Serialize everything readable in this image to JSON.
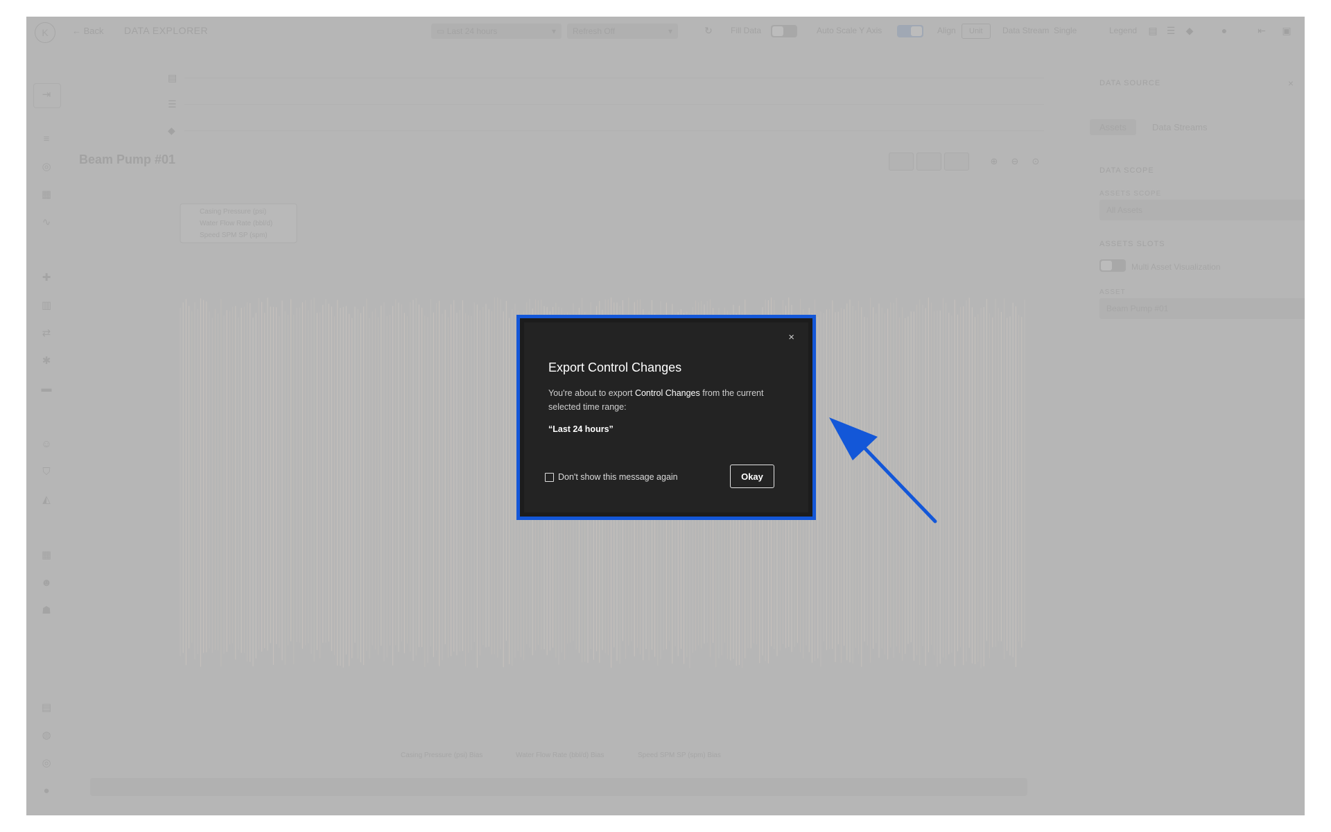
{
  "topbar": {
    "logo": "K",
    "back_label": "Back",
    "page_title": "DATA EXPLORER",
    "time_range": "Last 24 hours",
    "refresh": "Refresh Off",
    "fill_data_label": "Fill Data",
    "auto_scale_label": "Auto Scale Y Axis",
    "align_label": "Align",
    "unit_label": "Unit",
    "data_stream_label": "Data Stream",
    "single_label": "Single",
    "legend_label": "Legend"
  },
  "chart": {
    "asset_title": "Beam Pump #01",
    "legend": [
      "Casing Pressure (psi)",
      "Water Flow Rate (bbl/d)",
      "Speed SPM SP (spm)"
    ],
    "bottom_legend": [
      "Casing Pressure (psi) Bias",
      "Water Flow Rate (bbl/d) Bias",
      "Speed SPM SP (spm) Bias"
    ]
  },
  "right_panel": {
    "header": "DATA SOURCE",
    "tabs": [
      "Assets",
      "Data Streams"
    ],
    "data_scope_label": "DATA SCOPE",
    "assets_scope_label": "ASSETS SCOPE",
    "assets_scope_value": "All Assets",
    "assets_slots_label": "ASSETS SLOTS",
    "multi_asset_label": "Multi Asset Visualization",
    "asset_label": "ASSET",
    "asset_value": "Beam Pump #01"
  },
  "modal": {
    "title": "Export Control Changes",
    "body_prefix": "You're about to export",
    "body_highlight": "Control Changes",
    "body_suffix": "from the current selected time range:",
    "range": "“Last 24 hours”",
    "checkbox_label": "Don't show this message again",
    "ok_label": "Okay",
    "close_symbol": "×"
  },
  "colors": {
    "highlight": "#1357d8",
    "modal_bg": "#232323",
    "overlay": "#b6b6b6"
  }
}
